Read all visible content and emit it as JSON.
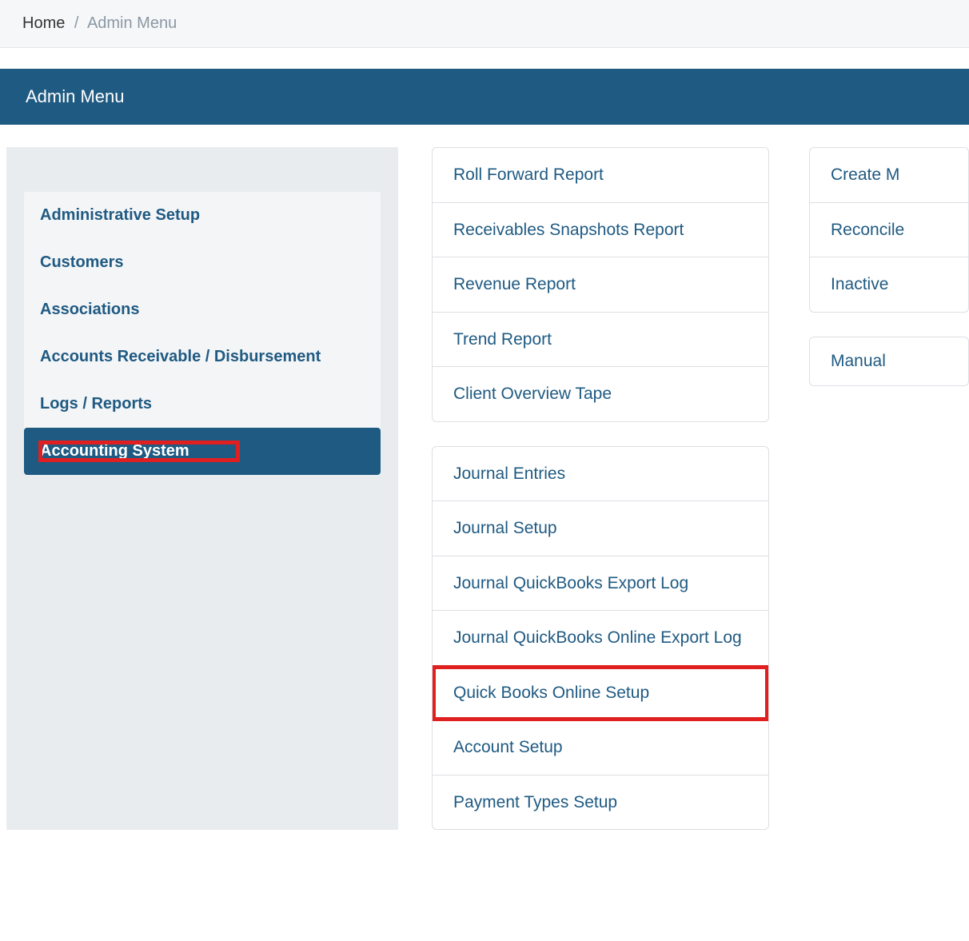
{
  "breadcrumb": {
    "home": "Home",
    "sep": "/",
    "current": "Admin Menu"
  },
  "header": {
    "title": "Admin Menu"
  },
  "sidebar": {
    "items": [
      {
        "label": "Administrative Setup"
      },
      {
        "label": "Customers"
      },
      {
        "label": "Associations"
      },
      {
        "label": "Accounts Receivable / Disbursement"
      },
      {
        "label": "Logs / Reports"
      },
      {
        "label": "Accounting System"
      }
    ]
  },
  "center": {
    "group1": [
      "Roll Forward Report",
      "Receivables Snapshots Report",
      "Revenue Report",
      "Trend Report",
      "Client Overview Tape"
    ],
    "group2": [
      "Journal Entries",
      "Journal Setup",
      "Journal QuickBooks Export Log",
      "Journal QuickBooks Online Export Log",
      "Quick Books Online Setup",
      "Account Setup",
      "Payment Types Setup"
    ]
  },
  "right": {
    "group1": [
      "Create M",
      "Reconcile",
      "Inactive "
    ],
    "standalone": "Manual "
  }
}
